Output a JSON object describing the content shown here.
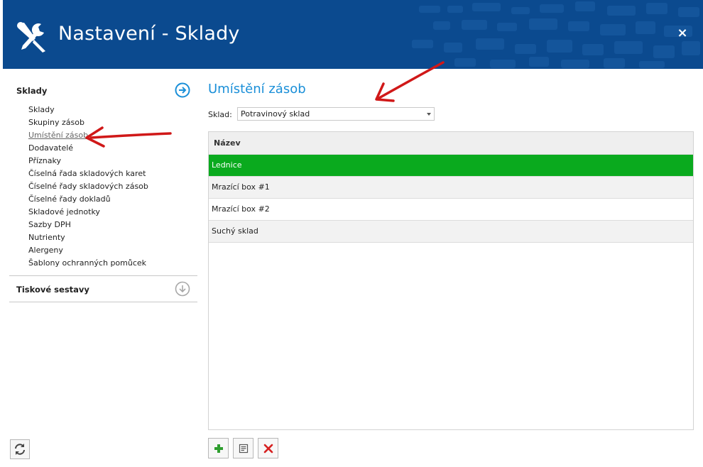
{
  "window": {
    "title": "Nastavení - Sklady",
    "close_glyph": "×",
    "icons": {
      "app": "wrench-screwdriver-icon",
      "close": "close-icon"
    }
  },
  "sidebar": {
    "sections": [
      {
        "label": "Sklady",
        "icon": "arrow-right-circle-icon",
        "items": [
          {
            "label": "Sklady"
          },
          {
            "label": "Skupiny zásob"
          },
          {
            "label": "Umístění zásob",
            "active": true
          },
          {
            "label": "Dodavatelé"
          },
          {
            "label": "Příznaky"
          },
          {
            "label": "Číselná řada skladových karet"
          },
          {
            "label": "Číselné řady skladových zásob"
          },
          {
            "label": "Číselné řady dokladů"
          },
          {
            "label": "Skladové jednotky"
          },
          {
            "label": "Sazby DPH"
          },
          {
            "label": "Nutrienty"
          },
          {
            "label": "Alergeny"
          },
          {
            "label": "Šablony ochranných pomůcek"
          }
        ]
      },
      {
        "label": "Tiskové sestavy",
        "icon": "arrow-down-circle-icon"
      }
    ],
    "refresh_icon": "refresh-icon"
  },
  "main": {
    "title": "Umístění zásob",
    "sklad": {
      "label": "Sklad:",
      "value": "Potravinový sklad"
    },
    "table": {
      "column": "Název",
      "rows": [
        {
          "name": "Lednice",
          "selected": true
        },
        {
          "name": "Mrazící box #1"
        },
        {
          "name": "Mrazící box #2"
        },
        {
          "name": "Suchý sklad"
        }
      ]
    },
    "toolbar": [
      {
        "icon": "plus-icon",
        "color": "#2e9e2e"
      },
      {
        "icon": "edit-document-icon",
        "color": "#555555"
      },
      {
        "icon": "delete-x-icon",
        "color": "#d62020"
      }
    ]
  },
  "colors": {
    "header": "#0b4a8f",
    "accent": "#1a8fd8",
    "selected_row": "#0aaa1e",
    "annotation_arrow": "#d01818"
  }
}
